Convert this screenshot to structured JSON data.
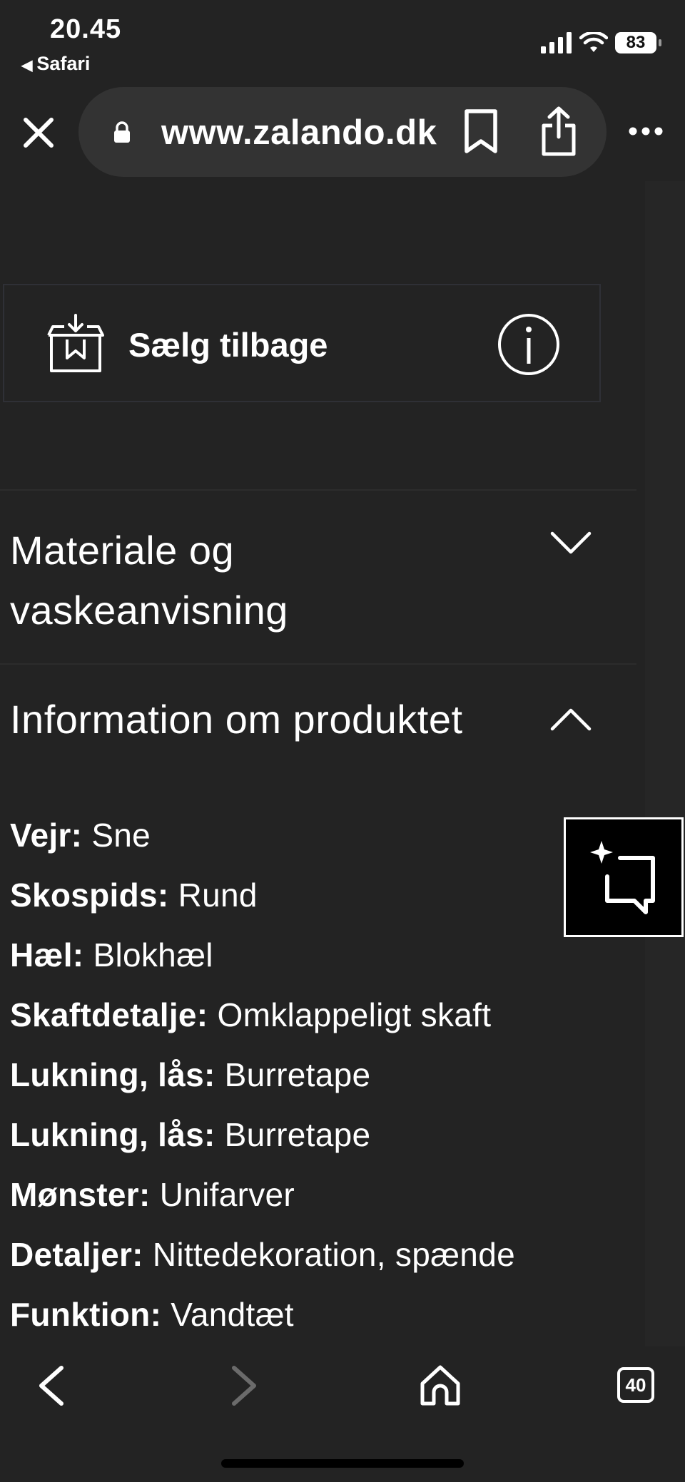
{
  "status_bar": {
    "time": "20.45",
    "back_app": "Safari",
    "battery": "83"
  },
  "browser": {
    "url": "www.zalando.dk",
    "tab_count": "40"
  },
  "sell_back": {
    "label": "Sælg tilbage"
  },
  "sections": {
    "material": {
      "title": "Materiale og vaskeanvisning",
      "expanded": false
    },
    "info": {
      "title": "Information om produktet",
      "expanded": true
    }
  },
  "specs": [
    {
      "key": "Vejr:",
      "value": " Sne"
    },
    {
      "key": "Skospids:",
      "value": " Rund"
    },
    {
      "key": "Hæl:",
      "value": " Blokhæl"
    },
    {
      "key": "Skaftdetalje:",
      "value": " Omklappeligt skaft"
    },
    {
      "key": "Lukning, lås:",
      "value": " Burretape"
    },
    {
      "key": "Lukning, lås:",
      "value": " Burretape"
    },
    {
      "key": "Mønster:",
      "value": " Unifarver"
    },
    {
      "key": "Detaljer:",
      "value": " Nittedekoration, spænde"
    },
    {
      "key": "Funktion:",
      "value": " Vandtæt"
    }
  ],
  "colors": {
    "background": "#232323",
    "url_pill": "#333333",
    "text": "#ffffff"
  }
}
